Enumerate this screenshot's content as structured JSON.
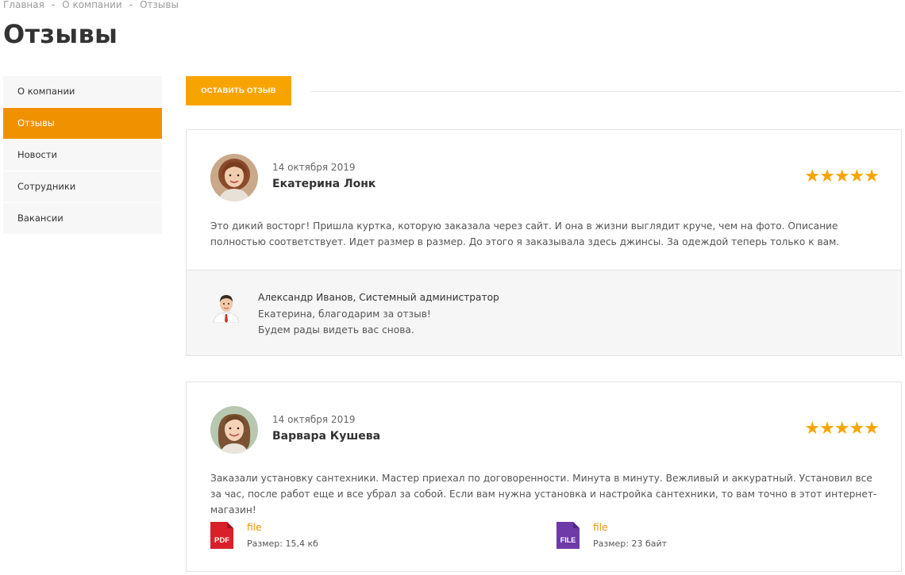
{
  "breadcrumb": [
    "Главная",
    "О компании",
    "Отзывы"
  ],
  "breadcrumb_sep": "-",
  "page_title": "Отзывы",
  "sidebar": {
    "items": [
      {
        "label": "О компании",
        "active": false
      },
      {
        "label": "Отзывы",
        "active": true
      },
      {
        "label": "Новости",
        "active": false
      },
      {
        "label": "Сотрудники",
        "active": false
      },
      {
        "label": "Вакансии",
        "active": false
      }
    ]
  },
  "cta_label": "ОСТАВИТЬ ОТЗЫВ",
  "colors": {
    "accent": "#f8a400",
    "active": "#f09100"
  },
  "reviews": [
    {
      "date": "14 октября 2019",
      "name": "Екатерина Лонк",
      "rating": 5,
      "stars": "★★★★★",
      "text": "Это дикий восторг! Пришла куртка, которую заказала через сайт. И она в жизни выглядит круче, чем на фото. Описание полностью соответствует. Идет размер в размер. До этого я заказывала здесь джинсы. За одеждой теперь только к вам.",
      "answer": {
        "author": "Александр Иванов, Системный администратор",
        "line1": "Екатерина, благодарим за отзыв!",
        "line2": "Будем рады видеть вас снова."
      }
    },
    {
      "date": "14 октября 2019",
      "name": "Варвара Кушева",
      "rating": 5,
      "stars": "★★★★★",
      "text": "Заказали установку сантехники. Мастер приехал по договоренности. Минута в минуту. Вежливый и аккуратный. Установил все за час, после работ еще и все убрал за собой. Если вам нужна установка и настройка сантехники, то вам точно в этот интернет-магазин!",
      "files": [
        {
          "icon_label": "PDF",
          "icon": "pdf-file-icon",
          "name": "file",
          "size": "Размер: 15,4 кб",
          "color": "#d9202a"
        },
        {
          "icon_label": "FILE",
          "icon": "generic-file-icon",
          "name": "file",
          "size": "Размер: 23 байт",
          "color": "#6e3aa8"
        }
      ]
    }
  ]
}
